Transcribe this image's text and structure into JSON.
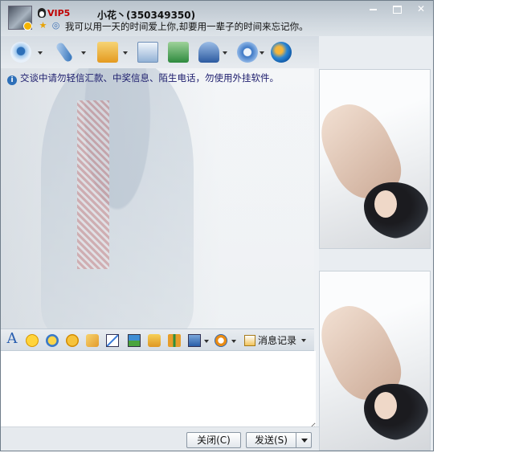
{
  "header": {
    "vip_label": "VIP5",
    "contact_name": "小花丶(350349350)",
    "signature": "我可以用一天的时间爱上你,却要用一辈子的时间来忘记你。"
  },
  "icons": {
    "avatar": "avatar-icon",
    "vip": "penguin-vip-icon",
    "star": "star-icon",
    "ring": "status-ring-icon",
    "video": "video-camera-icon",
    "voice": "microphone-icon",
    "file": "folder-icon",
    "sms": "envelope-icon",
    "add": "add-member-icon",
    "contact": "contact-card-icon",
    "settings": "gear-icon",
    "app": "app-launcher-icon",
    "info": "info-icon",
    "font": "font-icon",
    "emoji": "smile-icon",
    "magic": "magic-face-icon",
    "vibrate": "window-shake-icon",
    "doodle": "doodle-icon",
    "screenshot": "screen-capture-icon",
    "image": "picture-icon",
    "music": "music-icon",
    "gift": "gift-icon",
    "capture": "monitor-icon",
    "pay": "payment-icon",
    "history": "chat-history-icon"
  },
  "window_controls": {
    "minimize": "",
    "maximize": "",
    "close": "✕"
  },
  "chat": {
    "notice": "交谈中请勿轻信汇款、中奖信息、陌生电话，勿使用外挂软件。"
  },
  "format_toolbar": {
    "font_label": "A",
    "history_label": "消息记录"
  },
  "input": {
    "value": ""
  },
  "buttons": {
    "close": "关闭(C)",
    "send": "发送(S)"
  },
  "colors": {
    "accent": "#2d6fb8",
    "header_bg": "#cfd7de",
    "vip": "#c00000"
  }
}
